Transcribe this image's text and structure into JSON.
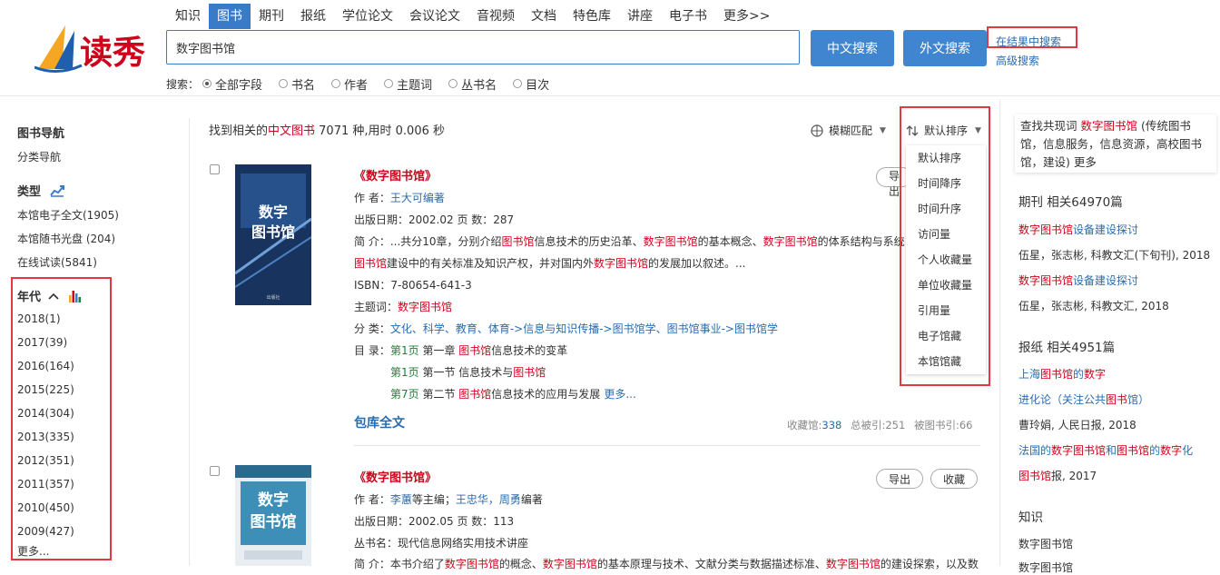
{
  "logo_text": "读秀",
  "nav_tabs": [
    "知识",
    "图书",
    "期刊",
    "报纸",
    "学位论文",
    "会议论文",
    "音视频",
    "文档",
    "特色库",
    "讲座",
    "电子书",
    "更多>>"
  ],
  "active_tab_index": 1,
  "search": {
    "query": "数字图书馆",
    "btn_chinese": "中文搜索",
    "btn_foreign": "外文搜索",
    "in_results": "在结果中搜索",
    "advanced": "高级搜索"
  },
  "fields": {
    "label": "搜索：",
    "options": [
      "全部字段",
      "书名",
      "作者",
      "主题词",
      "丛书名",
      "目次"
    ],
    "selected_index": 0
  },
  "sidebar": {
    "nav_title": "图书导航",
    "nav_sub": "分类导航",
    "type_title": "类型",
    "type_items": [
      "本馆电子全文(1905)",
      "本馆随书光盘 (204)",
      "在线试读(5841)"
    ],
    "year_title": "年代",
    "year_items": [
      "2018(1)",
      "2017(39)",
      "2016(164)",
      "2015(225)",
      "2014(304)",
      "2013(335)",
      "2012(351)",
      "2011(357)",
      "2010(450)",
      "2009(427)"
    ],
    "more": "更多..."
  },
  "summary": {
    "prefix": "找到相关的",
    "highlight": "中文图书",
    "rest": " 7071 种,用时 0.006 秒"
  },
  "fuzzy": "模糊匹配",
  "sort": {
    "label": "默认排序",
    "options": [
      "默认排序",
      "时间降序",
      "时间升序",
      "访问量",
      "个人收藏量",
      "单位收藏量",
      "引用量",
      "电子馆藏",
      "本馆馆藏"
    ]
  },
  "results": [
    {
      "cover_title": "数字图书馆",
      "title": "《数字图书馆》",
      "author_label": "作 者：",
      "author": "王大可编著",
      "date_line": "出版日期：2002.02      页  数：287",
      "abs_label": "简 介：",
      "abs_seg": [
        "...共分10章，分别介绍",
        "图书馆",
        "信息技术的历史沿革、",
        "数字图书馆",
        "的基本概念、",
        "数字图书馆",
        "的体系结构与系统"
      ],
      "abs_seg2": [
        "图书馆",
        "建设中的有关标准及知识产权，并对国内外",
        "数字图书馆",
        "的发展加以叙述。..."
      ],
      "isbn": "ISBN：7-80654-641-3",
      "subject_label": "主题词：",
      "subject": "数字图书馆",
      "class_label": "分  类：",
      "class_value": "文化、科学、教育、体育->信息与知识传播->图书馆学、图书馆事业->图书馆学",
      "toc_label": "目  录：",
      "toc": [
        {
          "page": "第1页",
          "pre": " 第一章 ",
          "hl": "图书馆",
          "post": "信息技术的变革"
        },
        {
          "page": "第1页",
          "pre": " 第一节 信息技术与",
          "hl": "图书馆",
          "post": ""
        },
        {
          "page": "第7页",
          "pre": " 第二节 ",
          "hl": "图书馆",
          "post": "信息技术的应用与发展"
        }
      ],
      "toc_more": "更多...",
      "fulltext": "包库全文",
      "stats": {
        "collect_label": "收藏馆:",
        "collect": "338",
        "cited": "总被引:251",
        "bookcited": "被图书引:66"
      },
      "btn_export": "导出"
    },
    {
      "cover_title": "数字图书馆",
      "title": "《数字图书馆》",
      "author_label": "作 者：",
      "author_a": "李蕙",
      "author_mid": "等主编；",
      "author_b": "王忠华，周勇",
      "author_end": "编著",
      "date_line": "出版日期：2002.05      页  数：113",
      "series": "丛书名：现代信息网络实用技术讲座",
      "abs_label": "简 介：",
      "abs_seg": [
        "本书介绍了",
        "数字图书馆",
        "的概念、",
        "数字图书馆",
        "的基本原理与技术、文献分类与数据描述标准、",
        "数字图书馆",
        "的建设探索，以及数"
      ],
      "btn_export": "导出",
      "btn_collect": "收藏"
    }
  ],
  "right": {
    "cooc_pre": "查找共现词 ",
    "cooc_hl": "数字图书馆",
    "cooc_rest": " (传统图书馆，信息服务，信息资源，高校图书馆，建设)  ",
    "cooc_more": "更多",
    "journal_head": "期刊  相关64970篇",
    "journal_items": [
      {
        "hl": "数字图书馆",
        "rest": "设备建设探讨",
        "meta": "伍星，张志彬, 科教文汇(下旬刊), 2018"
      },
      {
        "hl": "数字图书馆",
        "rest": "设备建设探讨",
        "meta": "伍星，张志彬, 科教文汇, 2018"
      }
    ],
    "paper_head": "报纸  相关4951篇",
    "paper_item1": [
      "上海",
      "图书馆",
      "的",
      "数字",
      "进化论（关注公共",
      "图书",
      "馆）"
    ],
    "paper_meta1": "曹玲娟, 人民日报, 2018",
    "paper_item2": [
      "法国的",
      "数字图书馆",
      "和",
      "图书馆",
      "的",
      "数字",
      "化"
    ],
    "paper_item2b": [
      "图书馆",
      "报, 2017"
    ],
    "knowledge_head": "知识",
    "knowledge_items": [
      "数字图书馆",
      "数字图书馆"
    ]
  },
  "colors": {
    "accent": "#3a7bc8",
    "highlight": "#d0021b",
    "annotation_red": "#e0393e"
  }
}
